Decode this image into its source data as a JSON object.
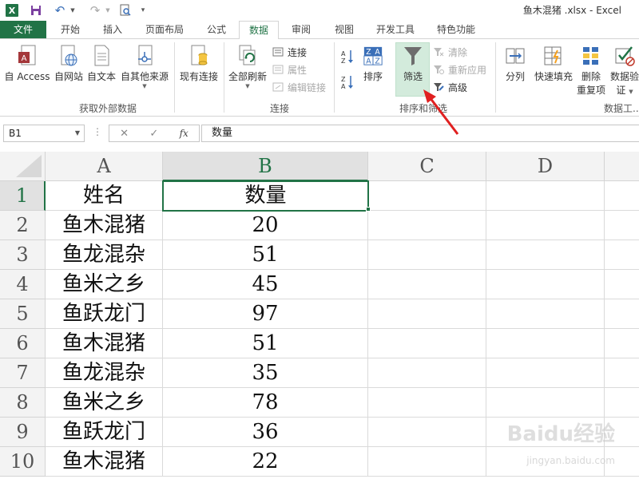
{
  "window": {
    "title": "鱼木混猪 .xlsx - Excel"
  },
  "tabs": [
    "文件",
    "开始",
    "插入",
    "页面布局",
    "公式",
    "数据",
    "审阅",
    "视图",
    "开发工具",
    "特色功能"
  ],
  "active_tab": "数据",
  "ribbon": {
    "get_external_data": {
      "label": "获取外部数据",
      "buttons": [
        "自 Access",
        "自网站",
        "自文本",
        "自其他来源"
      ]
    },
    "existing_connections": "现有连接",
    "connections": {
      "label": "连接",
      "refresh_all": "全部刷新",
      "items": [
        "连接",
        "属性",
        "编辑链接"
      ]
    },
    "sort_filter": {
      "label": "排序和筛选",
      "sort": "排序",
      "filter": "筛选",
      "items": [
        "清除",
        "重新应用",
        "高级"
      ]
    },
    "data_tools": {
      "label": "数据工...",
      "buttons": [
        "分列",
        "快速填充",
        "删除",
        "重复项",
        "数据验",
        "证"
      ]
    }
  },
  "formula_bar": {
    "name_box": "B1",
    "fx": "fx",
    "content": "数量"
  },
  "sheet": {
    "columns": [
      "A",
      "B",
      "C",
      "D"
    ],
    "row_numbers": [
      "1",
      "2",
      "3",
      "4",
      "5",
      "6",
      "7",
      "8",
      "9",
      "10"
    ],
    "rows": [
      [
        "姓名",
        "数量"
      ],
      [
        "鱼木混猪",
        "20"
      ],
      [
        "鱼龙混杂",
        "51"
      ],
      [
        "鱼米之乡",
        "45"
      ],
      [
        "鱼跃龙门",
        "97"
      ],
      [
        "鱼木混猪",
        "51"
      ],
      [
        "鱼龙混杂",
        "35"
      ],
      [
        "鱼米之乡",
        "78"
      ],
      [
        "鱼跃龙门",
        "36"
      ],
      [
        "鱼木混猪",
        "22"
      ]
    ],
    "selected_cell": "B1"
  },
  "watermark": {
    "brand": "Baidu经验",
    "url": "jingyan.baidu.com"
  },
  "colors": {
    "accent": "#217346",
    "filter_highlight": "#d3ebdc",
    "annotation_arrow": "#e02020"
  }
}
